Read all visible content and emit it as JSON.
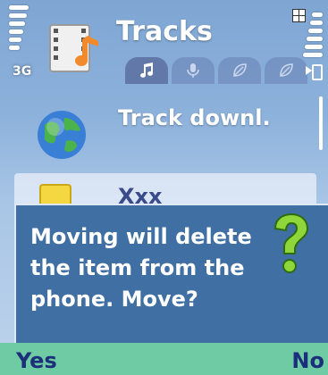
{
  "status": {
    "network": "3G",
    "signal_icon": "signal-strength-icon",
    "battery_icon": "battery-icon",
    "menu_icon": "multitasking-icon"
  },
  "header": {
    "title": "Tracks",
    "app_icon": "music-film-icon",
    "tabs": [
      {
        "icon": "music-note-icon",
        "active": true
      },
      {
        "icon": "microphone-icon",
        "active": false
      },
      {
        "icon": "leaf-icon",
        "active": false
      },
      {
        "icon": "leaf-icon",
        "active": false
      }
    ]
  },
  "list": {
    "items": [
      {
        "label": "Track downl.",
        "icon": "globe-icon"
      },
      {
        "label": "Xxx",
        "icon": "document-icon"
      }
    ]
  },
  "dialog": {
    "message": "Moving will delete the item from the phone. Move?",
    "icon": "question-mark-icon"
  },
  "softkeys": {
    "left": "Yes",
    "right": "No"
  },
  "colors": {
    "dialog_bg": "#3f6fa3",
    "softkey_bg": "#6ecba3",
    "softkey_text": "#1c2f7a"
  }
}
